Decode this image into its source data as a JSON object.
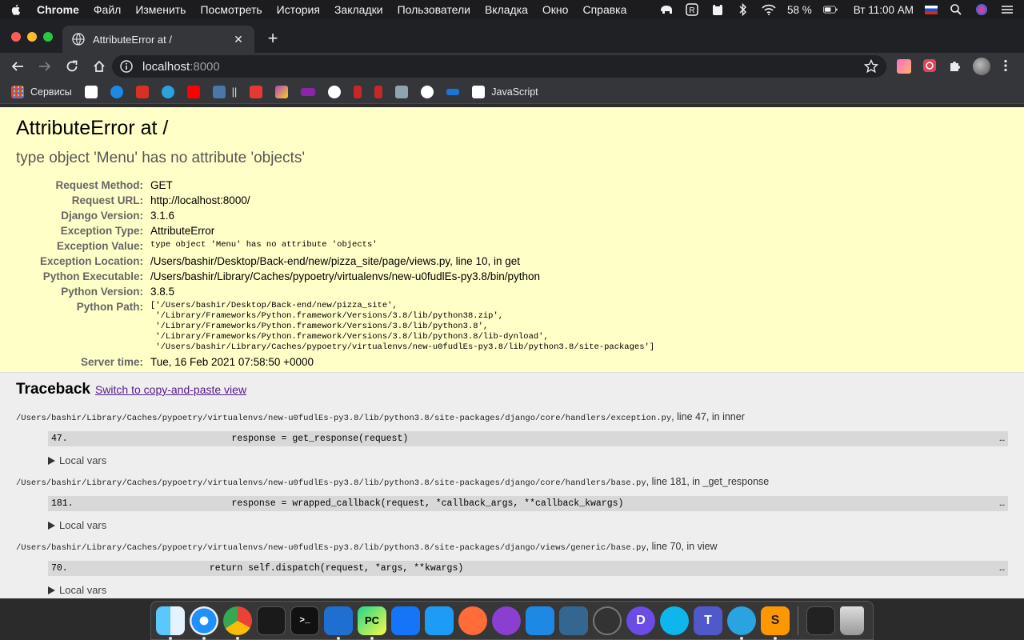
{
  "menubar": {
    "app": "Chrome",
    "items": [
      "Файл",
      "Изменить",
      "Посмотреть",
      "История",
      "Закладки",
      "Пользователи",
      "Вкладка",
      "Окно",
      "Справка"
    ],
    "battery": "58 %",
    "clock": "Вт 11:00 AM"
  },
  "browser": {
    "tab_title": "AttributeError at /",
    "url_host": "localhost",
    "url_port": ":8000",
    "bookmarks": {
      "apps_label": "Сервисы",
      "separator_label": "||",
      "js_label": "JavaScript"
    }
  },
  "error": {
    "title": "AttributeError at /",
    "subtitle": "type object 'Menu' has no attribute 'objects'",
    "meta": [
      {
        "label": "Request Method:",
        "value": "GET"
      },
      {
        "label": "Request URL:",
        "value": "http://localhost:8000/"
      },
      {
        "label": "Django Version:",
        "value": "3.1.6"
      },
      {
        "label": "Exception Type:",
        "value": "AttributeError"
      },
      {
        "label": "Exception Value:",
        "value": "type object 'Menu' has no attribute 'objects'"
      },
      {
        "label": "Exception Location:",
        "value": "/Users/bashir/Desktop/Back-end/new/pizza_site/page/views.py, line 10, in get"
      },
      {
        "label": "Python Executable:",
        "value": "/Users/bashir/Library/Caches/pypoetry/virtualenvs/new-u0fudlEs-py3.8/bin/python"
      },
      {
        "label": "Python Version:",
        "value": "3.8.5"
      },
      {
        "label": "Python Path:",
        "value": ""
      },
      {
        "label": "Server time:",
        "value": "Tue, 16 Feb 2021 07:58:50 +0000"
      }
    ],
    "python_path": [
      "['/Users/bashir/Desktop/Back-end/new/pizza_site',",
      " '/Library/Frameworks/Python.framework/Versions/3.8/lib/python38.zip',",
      " '/Library/Frameworks/Python.framework/Versions/3.8/lib/python3.8',",
      " '/Library/Frameworks/Python.framework/Versions/3.8/lib/python3.8/lib-dynload',",
      " '/Users/bashir/Library/Caches/pypoetry/virtualenvs/new-u0fudlEs-py3.8/lib/python3.8/site-packages']"
    ]
  },
  "traceback": {
    "heading": "Traceback",
    "switch_link": "Switch to copy-and-paste view",
    "local_vars_label": "Local vars",
    "frames": [
      {
        "path": "/Users/bashir/Library/Caches/pypoetry/virtualenvs/new-u0fudlEs-py3.8/lib/python3.8/site-packages/django/core/handlers/exception.py",
        "where": ", line 47, in inner",
        "lineno": "47.",
        "code": "                response = get_response(request)",
        "more": "…"
      },
      {
        "path": "/Users/bashir/Library/Caches/pypoetry/virtualenvs/new-u0fudlEs-py3.8/lib/python3.8/site-packages/django/core/handlers/base.py",
        "where": ", line 181, in _get_response",
        "lineno": "181.",
        "code": "                response = wrapped_callback(request, *callback_args, **callback_kwargs)",
        "more": "…"
      },
      {
        "path": "/Users/bashir/Library/Caches/pypoetry/virtualenvs/new-u0fudlEs-py3.8/lib/python3.8/site-packages/django/views/generic/base.py",
        "where": ", line 70, in view",
        "lineno": "70.",
        "code": "            return self.dispatch(request, *args, **kwargs)",
        "more": "…"
      }
    ]
  },
  "colors": {
    "summary_bg": "#ffffc8",
    "traceback_bg": "#eeeeee",
    "link": "#551a8b"
  }
}
